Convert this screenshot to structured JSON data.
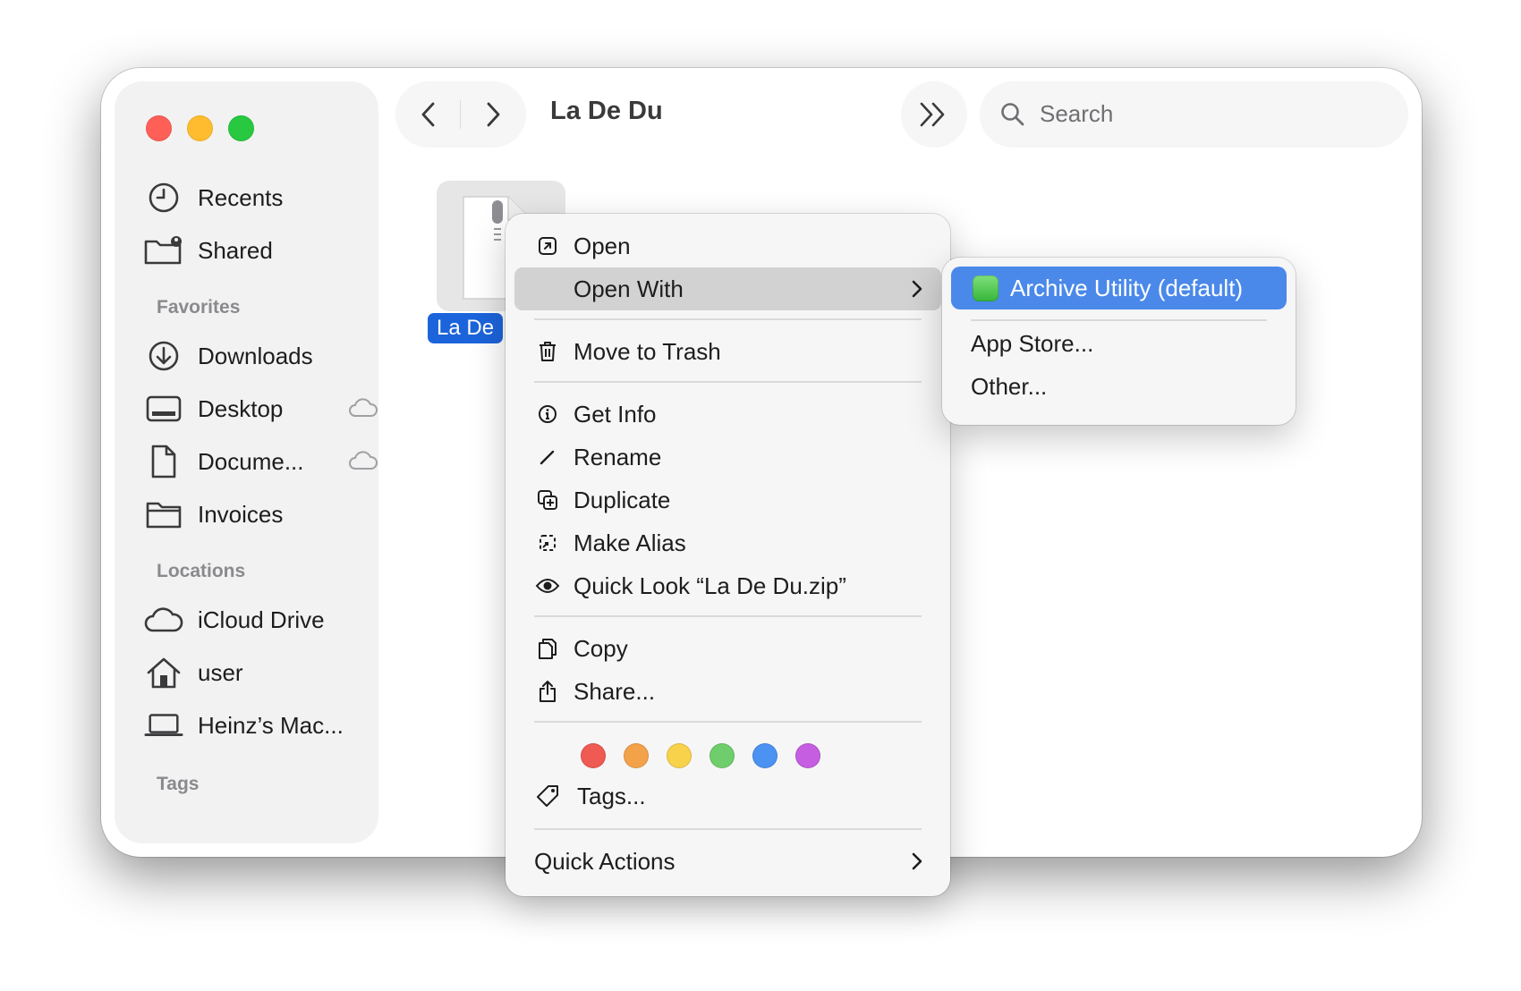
{
  "window": {
    "title": "La De Du"
  },
  "sidebar": {
    "items": [
      {
        "label": "Recents",
        "icon": "clock-icon"
      },
      {
        "label": "Shared",
        "icon": "shared-folder-icon"
      }
    ],
    "sections": [
      {
        "title": "Favorites",
        "items": [
          {
            "label": "Downloads",
            "icon": "download-icon"
          },
          {
            "label": "Desktop",
            "icon": "desktop-icon",
            "cloud": true
          },
          {
            "label": "Docume...",
            "icon": "document-icon",
            "cloud": true
          },
          {
            "label": "Invoices",
            "icon": "folder-icon"
          }
        ]
      },
      {
        "title": "Locations",
        "items": [
          {
            "label": "iCloud Drive",
            "icon": "cloud-icon"
          },
          {
            "label": "user",
            "icon": "home-icon"
          },
          {
            "label": "Heinz’s Mac...",
            "icon": "laptop-icon"
          }
        ]
      },
      {
        "title": "Tags",
        "items": []
      }
    ]
  },
  "toolbar": {
    "back_icon": "chevron-left-icon",
    "forward_icon": "chevron-right-icon",
    "more_icon": "double-chevron-right-icon",
    "search": {
      "placeholder": "Search"
    }
  },
  "file": {
    "label": "La De",
    "icon": "zip-file-icon"
  },
  "context_menu": {
    "items": {
      "open": "Open",
      "open_with": "Open With",
      "move_to_trash": "Move to Trash",
      "get_info": "Get Info",
      "rename": "Rename",
      "duplicate": "Duplicate",
      "make_alias": "Make Alias",
      "quick_look": "Quick Look “La De Du.zip”",
      "copy": "Copy",
      "share": "Share...",
      "tags": "Tags...",
      "quick_actions": "Quick Actions"
    },
    "tag_colors": [
      "#ef5a52",
      "#f4a24a",
      "#f8d24b",
      "#6fce6b",
      "#4b92f2",
      "#c55ee0"
    ]
  },
  "submenu": {
    "default_app": "Archive Utility (default)",
    "app_store": "App Store...",
    "other": "Other..."
  },
  "colors": {
    "selection_blue": "#4a89ea",
    "file_label_blue": "#1c64dc",
    "close": "#fe5f57",
    "minimize": "#febc2e",
    "zoom": "#28c840"
  }
}
